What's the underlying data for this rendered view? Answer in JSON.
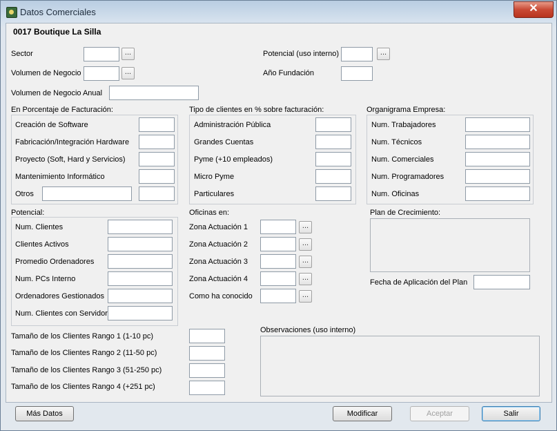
{
  "window": {
    "title": "Datos Comerciales",
    "close_label": "✕"
  },
  "header": {
    "title": "0017 Boutique La Silla"
  },
  "fields": {
    "sector": "Sector",
    "volumen_negocio": "Volumen de Negocio",
    "volumen_anual": "Volumen de Negocio Anual",
    "potencial_interno": "Potencial (uso interno)",
    "ano_fundacion": "Año Fundación",
    "lookup_label": "..."
  },
  "facturacion": {
    "title": "En Porcentaje de Facturación:",
    "items": [
      "Creación de Software",
      "Fabricación/Integración Hardware",
      "Proyecto (Soft, Hard y Servicios)",
      "Mantenimiento Informático",
      "Otros"
    ]
  },
  "tipo_clientes": {
    "title": "Tipo de clientes en % sobre facturación:",
    "items": [
      "Administración Pública",
      "Grandes Cuentas",
      "Pyme (+10 empleados)",
      "Micro Pyme",
      "Particulares"
    ]
  },
  "organigrama": {
    "title": "Organigrama Empresa:",
    "items": [
      "Num. Trabajadores",
      "Num. Técnicos",
      "Num. Comerciales",
      "Num. Programadores",
      "Num. Oficinas"
    ]
  },
  "potencial": {
    "title": "Potencial:",
    "items": [
      "Num. Clientes",
      "Clientes Activos",
      "Promedio Ordenadores",
      "Num. PCs Interno",
      "Ordenadores Gestionados",
      "Num. Clientes con Servidor"
    ]
  },
  "oficinas": {
    "title": "Oficinas en:",
    "items": [
      "Zona Actuación 1",
      "Zona Actuación 2",
      "Zona Actuación 3",
      "Zona Actuación 4",
      "Como ha conocido"
    ]
  },
  "plan": {
    "title": "Plan de Crecimiento:",
    "fecha": "Fecha de Aplicación del Plan"
  },
  "rangos": [
    "Tamaño de los Clientes Rango 1 (1-10 pc)",
    "Tamaño de los Clientes Rango 2 (11-50 pc)",
    "Tamaño de los Clientes Rango 3 (51-250 pc)",
    "Tamaño de los Clientes Rango 4 (+251 pc)"
  ],
  "observaciones": {
    "title": "Observaciones (uso interno)"
  },
  "buttons": {
    "mas_datos": "Más Datos",
    "modificar": "Modificar",
    "aceptar": "Aceptar",
    "salir": "Salir"
  }
}
